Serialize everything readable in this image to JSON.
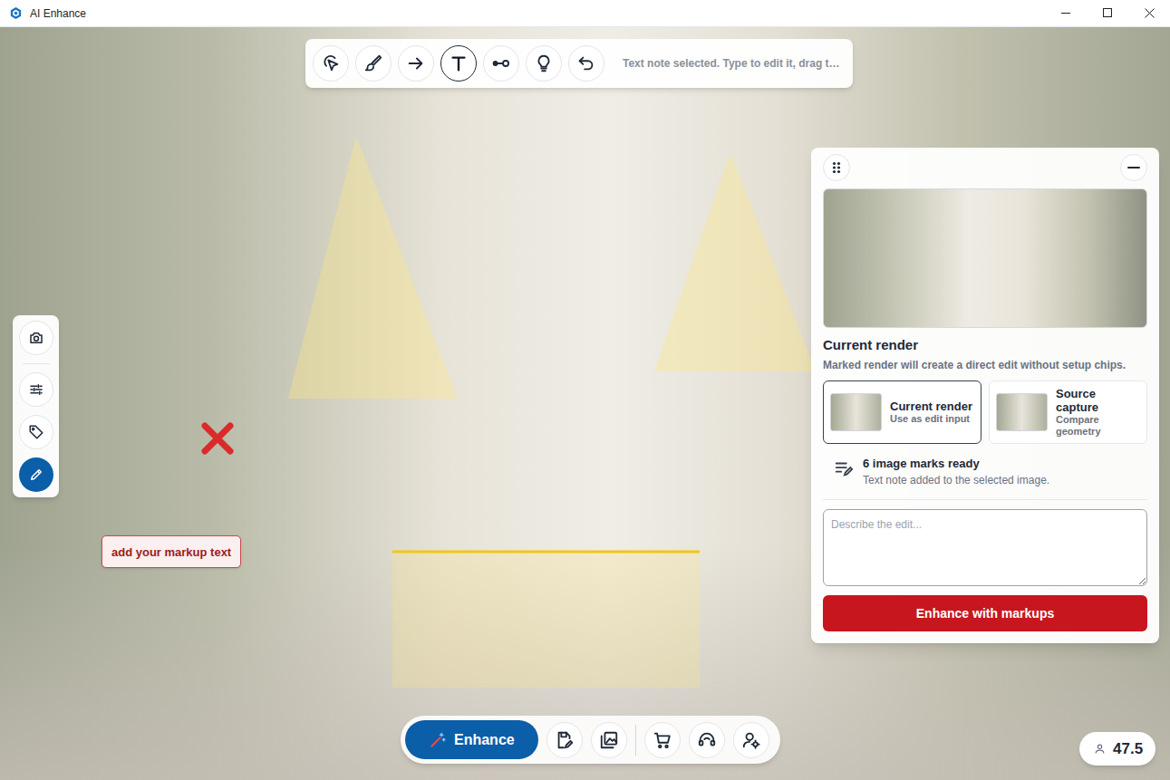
{
  "window": {
    "title": "AI Enhance"
  },
  "toolbar": {
    "tools": [
      {
        "kind": "select",
        "selected": false
      },
      {
        "kind": "brush",
        "selected": false
      },
      {
        "kind": "arrow",
        "selected": false
      },
      {
        "kind": "text",
        "selected": true
      },
      {
        "kind": "measure",
        "selected": false
      },
      {
        "kind": "light",
        "selected": false
      },
      {
        "kind": "undo",
        "selected": false
      }
    ],
    "status": "Text note selected. Type to edit it, drag t…"
  },
  "side_tools": [
    {
      "kind": "camera",
      "selected": false
    },
    {
      "kind": "adjust",
      "selected": false
    },
    {
      "kind": "tag",
      "selected": false
    },
    {
      "kind": "markup",
      "selected": true
    }
  ],
  "canvas": {
    "note": "add your markup text"
  },
  "panel": {
    "heading": "Current render",
    "description": "Marked render will create a direct edit without setup chips.",
    "sources": [
      {
        "title": "Current render",
        "subtitle": "Use as edit input",
        "selected": true
      },
      {
        "title": "Source capture",
        "subtitle": "Compare geometry",
        "selected": false
      }
    ],
    "marks": {
      "title": "6 image marks ready",
      "detail": "Text note added to the selected image."
    },
    "prompt": {
      "placeholder": "Describe the edit..."
    },
    "submit": "Enhance with markups"
  },
  "dock": {
    "enhance": "Enhance",
    "groups": [
      [
        {
          "kind": "save-edit"
        },
        {
          "kind": "gallery"
        }
      ],
      [
        {
          "kind": "cart"
        },
        {
          "kind": "support"
        },
        {
          "kind": "user-settings"
        }
      ]
    ]
  },
  "credits": "47.5"
}
